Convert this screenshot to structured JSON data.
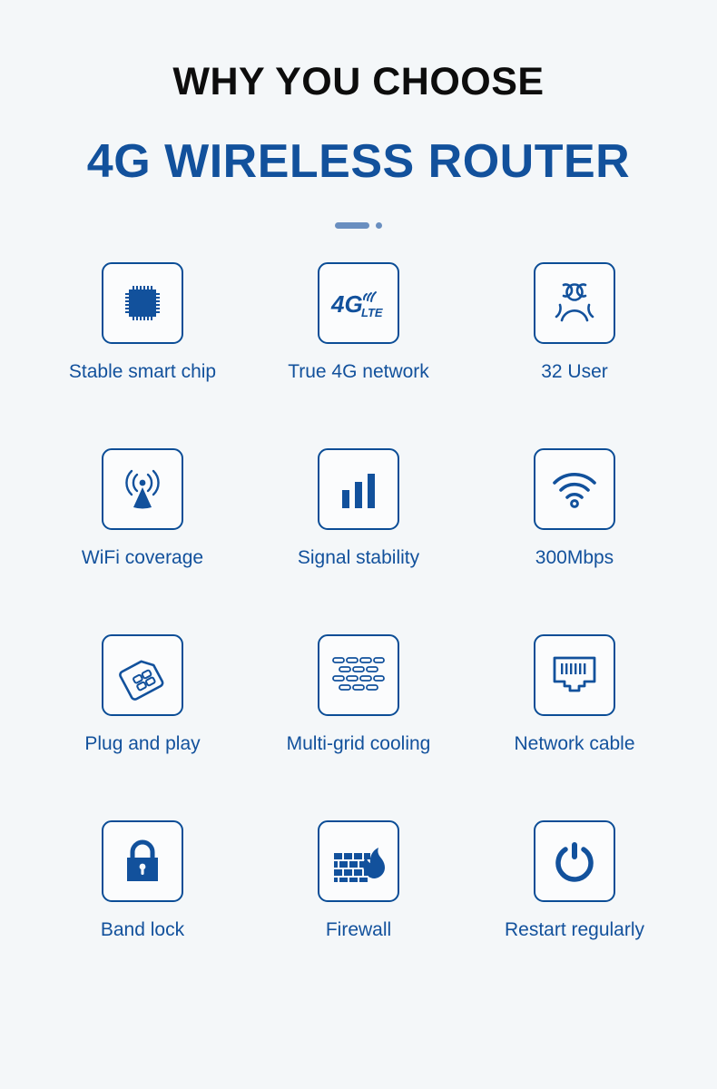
{
  "header": {
    "title_main": "WHY YOU CHOOSE",
    "title_sub": "4G WIRELESS ROUTER",
    "accent_color": "#12519c",
    "icon_color": "#0b4d96",
    "background_color": "#f4f7f9",
    "divider_color": "#6a8fc0"
  },
  "features": [
    {
      "label": "Stable smart chip",
      "icon": "chip-icon"
    },
    {
      "label": "True 4G network",
      "icon": "4g-lte-icon"
    },
    {
      "label": "32 User",
      "icon": "users-group-icon"
    },
    {
      "label": "WiFi coverage",
      "icon": "broadcast-tower-icon"
    },
    {
      "label": "Signal stability",
      "icon": "signal-bars-icon"
    },
    {
      "label": "300Mbps",
      "icon": "wifi-icon"
    },
    {
      "label": "Plug and play",
      "icon": "sim-card-icon"
    },
    {
      "label": "Multi-grid cooling",
      "icon": "vent-grid-icon"
    },
    {
      "label": "Network cable",
      "icon": "rj45-port-icon"
    },
    {
      "label": "Band lock",
      "icon": "padlock-icon"
    },
    {
      "label": "Firewall",
      "icon": "firewall-brick-flame-icon"
    },
    {
      "label": "Restart regularly",
      "icon": "power-icon"
    }
  ],
  "icon_text": {
    "four_g": "4G",
    "lte": "LTE"
  }
}
